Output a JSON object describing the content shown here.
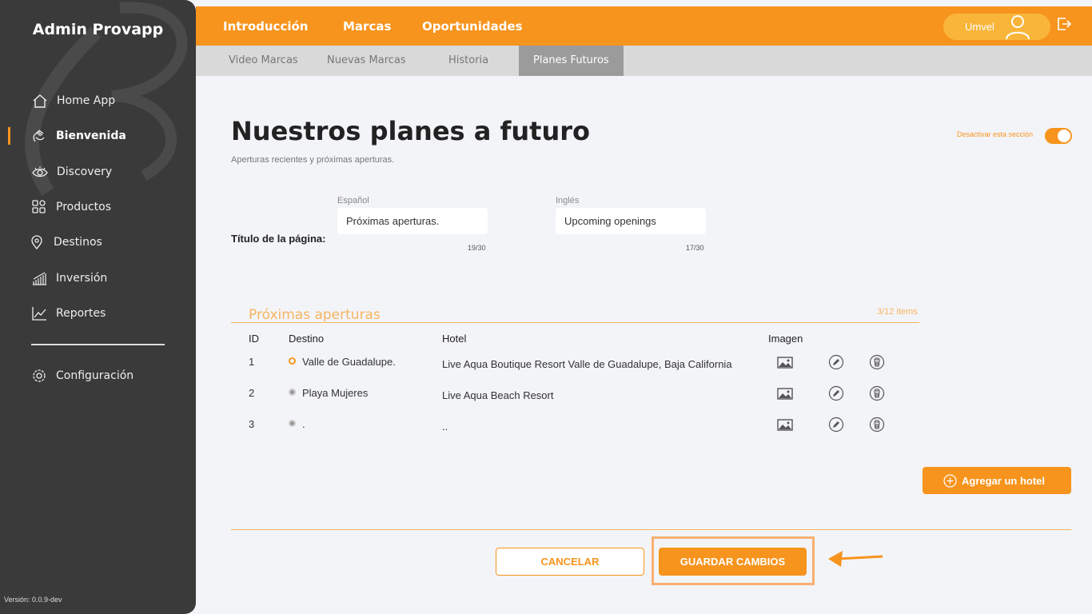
{
  "app": {
    "title": "Admin Provapp",
    "version": "Versión: 0.0.9-dev"
  },
  "sidebar": {
    "items": [
      {
        "label": "Home App",
        "icon": "home-icon"
      },
      {
        "label": "Bienvenida",
        "icon": "wave-hand-icon",
        "active": true
      },
      {
        "label": "Discovery",
        "icon": "eye-icon"
      },
      {
        "label": "Productos",
        "icon": "grid-icon"
      },
      {
        "label": "Destinos",
        "icon": "map-pin-icon"
      },
      {
        "label": "Inversión",
        "icon": "bar-chart-icon"
      },
      {
        "label": "Reportes",
        "icon": "line-chart-icon"
      }
    ],
    "settings": {
      "label": "Configuración",
      "icon": "gear-icon"
    }
  },
  "topnav": {
    "items": [
      "Introducción",
      "Marcas",
      "Oportunidades"
    ],
    "active": "Marcas",
    "user": "Umvel"
  },
  "subtabs": {
    "items": [
      "Video Marcas",
      "Nuevas Marcas",
      "Historia",
      "Planes Futuros"
    ],
    "active": "Planes Futuros"
  },
  "page": {
    "title": "Nuestros planes a futuro",
    "subtitle": "Aperturas recientes y próximas aperturas.",
    "toggle_label": "Desactivar esta sección",
    "title_label": "Título de la página:",
    "spanish_label": "Español",
    "spanish_value": "Próximas aperturas.",
    "spanish_count": "19/30",
    "english_label": "Inglés",
    "english_value": "Upcoming openings",
    "english_count": "17/30"
  },
  "section": {
    "title": "Próximas aperturas",
    "count": "3/12 items",
    "headers": {
      "id": "ID",
      "destino": "Destino",
      "hotel": "Hotel",
      "imagen": "Imagen"
    },
    "rows": [
      {
        "id": "1",
        "destino": "Valle de Guadalupe.",
        "hotel": "Live Aqua Boutique Resort Valle de Guadalupe, Baja California",
        "status": "on"
      },
      {
        "id": "2",
        "destino": "Playa Mujeres",
        "hotel": "Live Aqua Beach Resort",
        "status": "off"
      },
      {
        "id": "3",
        "destino": ".",
        "hotel": "..",
        "status": "off"
      }
    ],
    "add_label": "Agregar un hotel"
  },
  "footer": {
    "cancel": "CANCELAR",
    "save": "GUARDAR CAMBIOS"
  },
  "colors": {
    "accent": "#f7941d",
    "sidebar": "#3a3a3a",
    "subtabs": "#d9d9d9"
  }
}
